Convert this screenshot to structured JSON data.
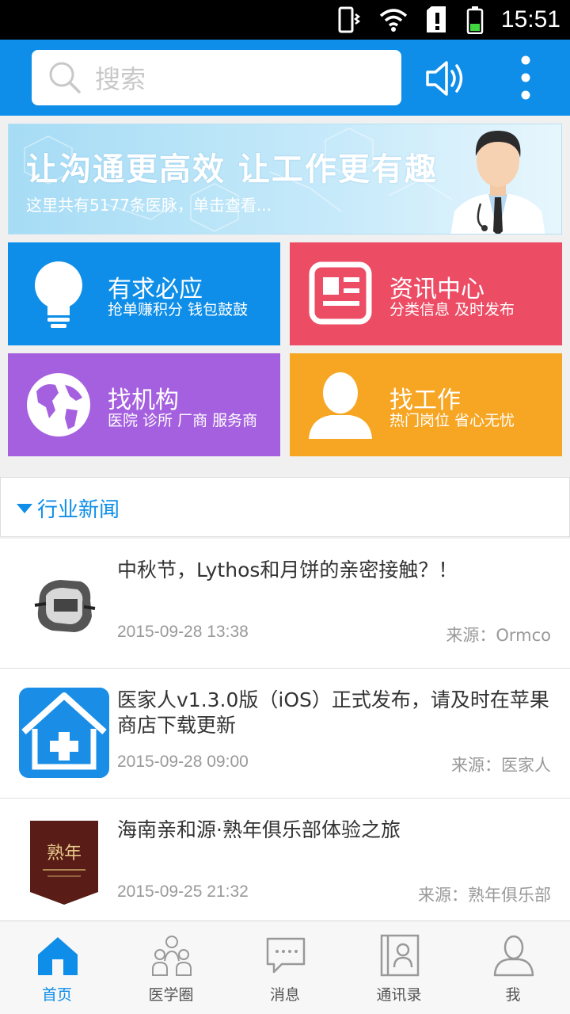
{
  "status": {
    "time": "15:51",
    "icons": [
      "vibrate-icon",
      "wifi-icon",
      "sim-alert-icon",
      "battery-icon"
    ]
  },
  "header": {
    "search_placeholder": "搜索",
    "icons": [
      "search-icon",
      "speaker-icon",
      "more-vert-icon"
    ]
  },
  "banner": {
    "title": "让沟通更高效  让工作更有趣",
    "subtitle": "这里共有5177条医脉，单击查看..."
  },
  "tiles": [
    {
      "title": "有求必应",
      "subtitle": "抢单赚积分 钱包鼓鼓",
      "icon": "lightbulb-icon",
      "color": "#0e8ee8"
    },
    {
      "title": "资讯中心",
      "subtitle": "分类信息 及时发布",
      "icon": "news-icon",
      "color": "#ec4c64"
    },
    {
      "title": "找机构",
      "subtitle": "医院 诊所 厂商 服务商",
      "icon": "globe-icon",
      "color": "#a560e0"
    },
    {
      "title": "找工作",
      "subtitle": "热门岗位 省心无忧",
      "icon": "person-icon",
      "color": "#f6a623"
    }
  ],
  "section": {
    "label": "行业新闻"
  },
  "news": [
    {
      "title": "中秋节，Lythos和月饼的亲密接触？！",
      "date": "2015-09-28 13:38",
      "source": "来源：Ormco"
    },
    {
      "title": "医家人v1.3.0版（iOS）正式发布，请及时在苹果商店下载更新",
      "date": "2015-09-28 09:00",
      "source": "来源：医家人"
    },
    {
      "title": "海南亲和源·熟年俱乐部体验之旅",
      "date": "2015-09-25 21:32",
      "source": "来源：熟年俱乐部",
      "thumb_text": "熟年"
    }
  ],
  "tabs": [
    {
      "label": "首页",
      "active": true
    },
    {
      "label": "医学圈",
      "active": false
    },
    {
      "label": "消息",
      "active": false
    },
    {
      "label": "通讯录",
      "active": false
    },
    {
      "label": "我",
      "active": false
    }
  ],
  "colors": {
    "accent": "#0e8ee8",
    "text": "#333333",
    "muted": "#999999"
  }
}
